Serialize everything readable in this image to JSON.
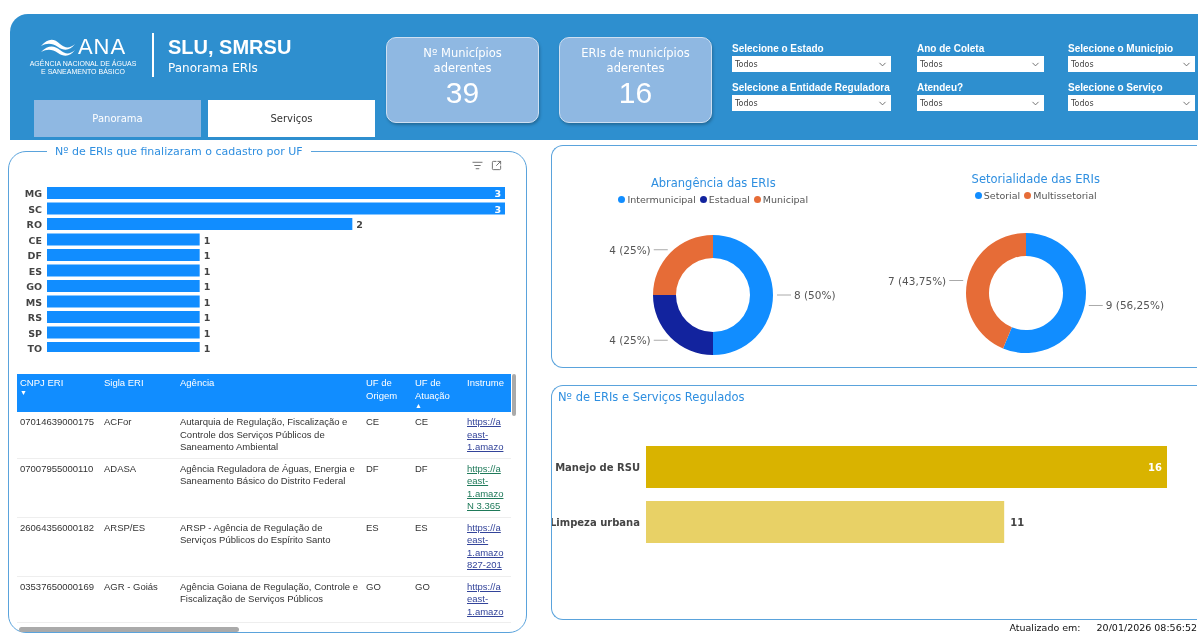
{
  "header": {
    "logo": {
      "acronym": "ANA",
      "subtitle_lines": [
        "AGÊNCIA NACIONAL DE ÁGUAS",
        "E SANEAMENTO BÁSICO"
      ]
    },
    "title": "SLU, SMRSU",
    "subtitle": "Panorama ERIs"
  },
  "tabs": [
    {
      "label": "Panorama",
      "selected": true
    },
    {
      "label": "Serviços",
      "selected": false
    }
  ],
  "kpis": [
    {
      "label": "Nº Municípios aderentes",
      "value": "39"
    },
    {
      "label": "ERIs de municípios aderentes",
      "value": "16"
    }
  ],
  "filters": [
    {
      "label": "Selecione o Estado",
      "value": "Todos"
    },
    {
      "label": "Ano de Coleta",
      "value": "Todos"
    },
    {
      "label": "Selecione o Município",
      "value": "Todos"
    },
    {
      "label": "Selecione a Entidade Reguladora",
      "value": "Todos"
    },
    {
      "label": "Atendeu?",
      "value": "Todos"
    },
    {
      "label": "Selecione o Serviço",
      "value": "Todos"
    }
  ],
  "uf_panel": {
    "title": "Nº de ERIs que finalizaram o cadastro por UF",
    "chart_data": {
      "type": "bar",
      "orientation": "horizontal",
      "categories": [
        "MG",
        "SC",
        "RO",
        "CE",
        "DF",
        "ES",
        "GO",
        "MS",
        "RS",
        "SP",
        "TO"
      ],
      "values": [
        3,
        3,
        2,
        1,
        1,
        1,
        1,
        1,
        1,
        1,
        1
      ],
      "data_labels": true
    },
    "table": {
      "columns": [
        {
          "label": "CNPJ ERI",
          "sort_arrow": "▼"
        },
        {
          "label": "Sigla ERI"
        },
        {
          "label": "Agência"
        },
        {
          "label": "UF de Origem"
        },
        {
          "label": "UF de Atuação",
          "sort_arrow": "▲"
        },
        {
          "label": "Instrume"
        }
      ],
      "rows": [
        {
          "cells": [
            "07014639000175",
            "ACFor",
            "Autarquia de Regulação, Fiscalização e Controle dos Serviços Públicos de Saneamento Ambiental",
            "CE",
            "CE"
          ],
          "link": {
            "lines": [
              "https://a",
              "east-",
              "1.amazo"
            ],
            "visited": false
          }
        },
        {
          "cells": [
            "07007955000110",
            "ADASA",
            "Agência Reguladora de Águas, Energia e Saneamento Básico do Distrito Federal",
            "DF",
            "DF"
          ],
          "link": {
            "lines": [
              "https://a",
              "east-",
              "1.amazo",
              "N 3.365"
            ],
            "visited": true
          }
        },
        {
          "cells": [
            "26064356000182",
            "ARSP/ES",
            "ARSP - Agência de Regulação de Serviços Públicos do Espírito Santo",
            "ES",
            "ES"
          ],
          "link": {
            "lines": [
              "https://a",
              "east-",
              "1.amazo",
              "827-201"
            ],
            "visited": false
          }
        },
        {
          "cells": [
            "03537650000169",
            "AGR - Goiás",
            "Agência Goiana de Regulação, Controle e Fiscalização de Serviços Públicos",
            "GO",
            "GO"
          ],
          "link": {
            "lines": [
              "https://a",
              "east-",
              "1.amazo"
            ],
            "visited": false
          }
        }
      ]
    }
  },
  "donuts": [
    {
      "title": "Abrangência das ERIs",
      "chart_data": {
        "type": "donut",
        "categories": [
          "Intermunicipal",
          "Estadual",
          "Municipal"
        ],
        "values": [
          8,
          4,
          4
        ],
        "colors": [
          "#118dff",
          "#12239e",
          "#e66c37"
        ],
        "value_labels": [
          "8 (50%)",
          "4 (25%)",
          "4 (25%)"
        ]
      }
    },
    {
      "title": "Setorialidade das ERIs",
      "chart_data": {
        "type": "donut",
        "categories": [
          "Setorial",
          "Multissetorial"
        ],
        "values": [
          9,
          7
        ],
        "colors": [
          "#118dff",
          "#e66c37"
        ],
        "value_labels": [
          "9 (56,25%)",
          "7 (43,75%)"
        ]
      }
    }
  ],
  "services_panel": {
    "title": "Nº de ERIs e Serviços Regulados",
    "chart_data": {
      "type": "bar",
      "orientation": "horizontal",
      "categories": [
        "Manejo de RSU",
        "Limpeza urbana"
      ],
      "values": [
        16,
        11
      ],
      "colors": [
        "#d9b300",
        "#e8d166"
      ],
      "data_labels": true
    }
  },
  "footer": {
    "label": "Atualizado em:",
    "timestamp": "20/01/2026 08:56:52"
  }
}
